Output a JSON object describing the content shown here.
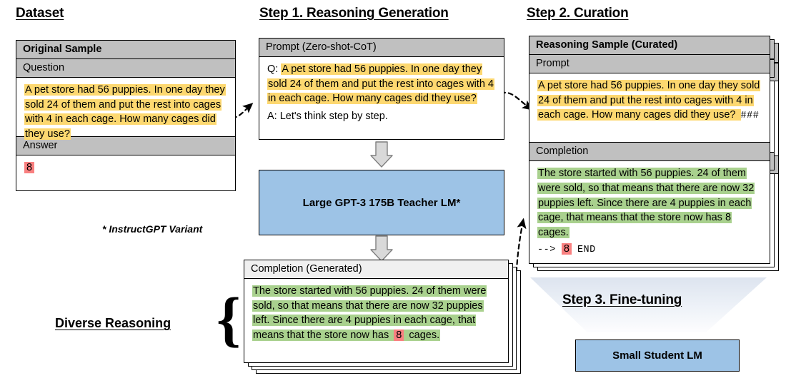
{
  "columns": {
    "dataset_title": "Dataset",
    "step1_title": "Step 1. Reasoning Generation",
    "step2_title": "Step 2. Curation",
    "step3_title": "Step 3. Fine-tuning"
  },
  "original_sample": {
    "header": "Original Sample",
    "question_label": "Question",
    "question_text": "A pet store had 56 puppies. In one day they sold 24 of them and put the rest into cages with 4 in each cage. How many cages did they use?",
    "answer_label": "Answer",
    "answer_value": "8"
  },
  "prompt_card": {
    "header": "Prompt (Zero-shot-CoT)",
    "q_prefix": "Q:",
    "question_text": "A pet store had 56 puppies. In one day they sold 24 of them and put the rest into cages with 4 in each cage. How many cages did they use?",
    "a_line": "A: Let's think step by step."
  },
  "teacher_lm": {
    "label": "Large GPT-3 175B Teacher LM*"
  },
  "footnote": {
    "text": "* InstructGPT Variant"
  },
  "completion_generated": {
    "header": "Completion (Generated)",
    "text_before": "The store started with 56 puppies. 24 of them were sold, so that means that there are now 32 puppies left.  Since there are 4 puppies in each cage, that means that the store now has",
    "answer_value": "8",
    "text_after": "cages."
  },
  "diverse_reasoning": {
    "label": "Diverse Reasoning",
    "brace": "{"
  },
  "reasoning_sample": {
    "header": "Reasoning Sample (Curated)",
    "prompt_label": "Prompt",
    "prompt_text": "A pet store had 56 puppies. In one day they sold 24 of them and put the rest into cages with 4 in each cage. How many cages did they use?",
    "prompt_suffix": "###",
    "completion_label": "Completion",
    "completion_text": "The store started with 56 puppies. 24 of them were sold, so that means that there are now 32 puppies left.  Since there are 4 puppies in each cage, that means that the store now has 8 cages.",
    "arrow_token": "-->",
    "answer_value": "8",
    "end_token": "END"
  },
  "student_lm": {
    "label": "Small Student LM"
  },
  "colors": {
    "highlight_yellow": "#fdd870",
    "highlight_green": "#a9d18e",
    "highlight_pink": "#f98080",
    "lm_blue": "#9dc3e6",
    "header_gray": "#c0c0c0",
    "header_light_gray": "#f0f0f0",
    "outline_black": "#000000"
  }
}
